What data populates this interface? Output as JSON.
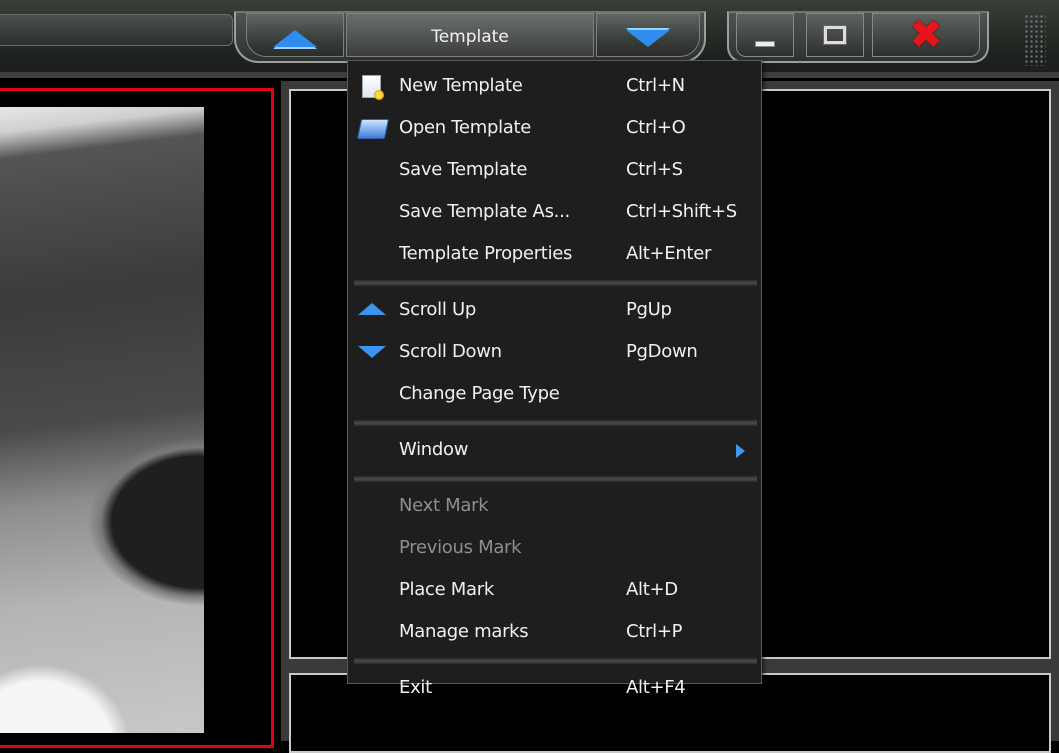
{
  "toolbar": {
    "menu_button_label": "Template",
    "scroll_up_icon": "triangle-up-icon",
    "scroll_down_icon": "triangle-down-icon"
  },
  "window_controls": {
    "minimize_icon": "minimize-icon",
    "maximize_icon": "maximize-icon",
    "close_icon": "close-icon",
    "close_glyph": "✖"
  },
  "colors": {
    "accent_blue": "#2f8df0",
    "close_red": "#e8141a",
    "frame_red": "#e3000f",
    "menu_bg": "#1e1e1e",
    "disabled_text": "#8e8e8e"
  },
  "menu": {
    "groups": [
      [
        {
          "label": "New Template",
          "shortcut": "Ctrl+N",
          "icon": "new-document-icon"
        },
        {
          "label": "Open Template",
          "shortcut": "Ctrl+O",
          "icon": "open-folder-icon"
        },
        {
          "label": "Save Template",
          "shortcut": "Ctrl+S"
        },
        {
          "label": "Save Template As...",
          "shortcut": "Ctrl+Shift+S"
        },
        {
          "label": "Template Properties",
          "shortcut": "Alt+Enter"
        }
      ],
      [
        {
          "label": "Scroll Up",
          "shortcut": "PgUp",
          "icon": "scroll-up-icon"
        },
        {
          "label": "Scroll Down",
          "shortcut": "PgDown",
          "icon": "scroll-down-icon"
        },
        {
          "label": "Change Page Type",
          "shortcut": ""
        }
      ],
      [
        {
          "label": "Window",
          "shortcut": "",
          "submenu": true
        }
      ],
      [
        {
          "label": "Next Mark",
          "shortcut": "",
          "disabled": true
        },
        {
          "label": "Previous Mark",
          "shortcut": "",
          "disabled": true
        },
        {
          "label": "Place Mark",
          "shortcut": "Alt+D"
        },
        {
          "label": "Manage marks",
          "shortcut": "Ctrl+P"
        }
      ],
      [
        {
          "label": "Exit",
          "shortcut": "Alt+F4"
        }
      ]
    ]
  }
}
